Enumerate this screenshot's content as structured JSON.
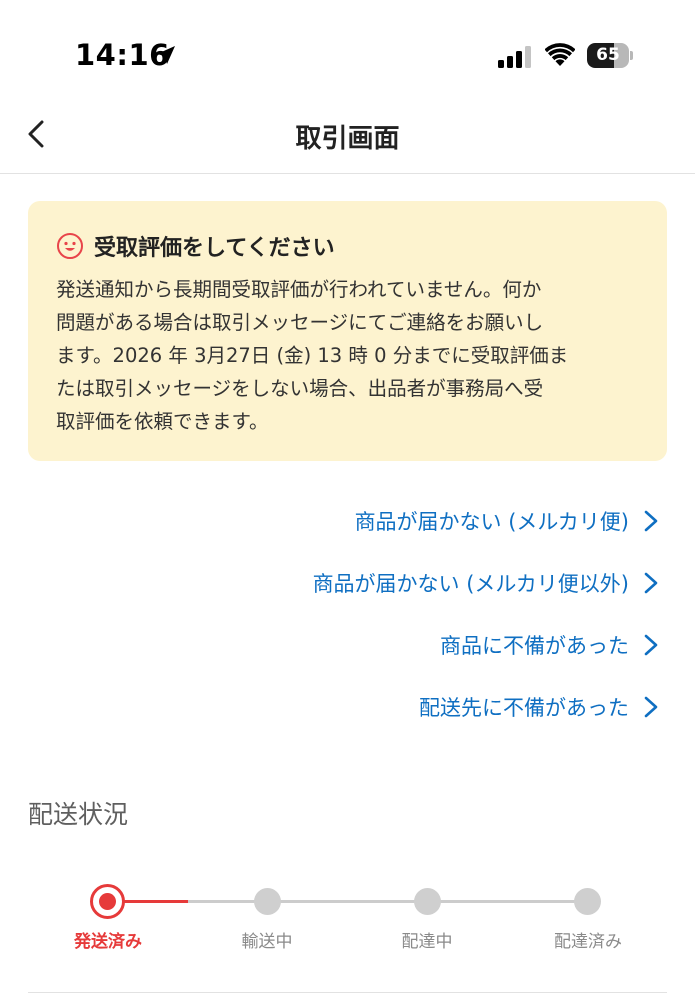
{
  "status_bar": {
    "time": "14:16",
    "battery_level": "65",
    "battery_fraction": 0.65,
    "location_icon": "location-arrow-icon",
    "signal_icon": "cellular-signal-icon",
    "wifi_icon": "wifi-icon"
  },
  "nav": {
    "title": "取引画面",
    "back_icon": "chevron-left-icon"
  },
  "notice": {
    "icon": "smiley-face-icon",
    "title": "受取評価をしてください",
    "body_lines": [
      "発送通知から長期間受取評価が行われていません。何か",
      "問題がある場合は取引メッセージにてご連絡をお願いし",
      "ます。2026 年 3月27日 (金) 13 時 0 分までに受取評価ま",
      "たは取引メッセージをしない場合、出品者が事務局へ受",
      "取評価を依頼できます。"
    ],
    "background_color": "#fdf3cf"
  },
  "links": [
    {
      "label": "商品が届かない (メルカリ便)"
    },
    {
      "label": "商品が届かない (メルカリ便以外)"
    },
    {
      "label": "商品に不備があった"
    },
    {
      "label": "配送先に不備があった"
    }
  ],
  "shipping_section": {
    "title": "配送状況",
    "steps": [
      {
        "label": "発送済み",
        "active": true
      },
      {
        "label": "輸送中",
        "active": false
      },
      {
        "label": "配達中",
        "active": false
      },
      {
        "label": "配達済み",
        "active": false
      }
    ]
  },
  "colors": {
    "link": "#0f6fc2",
    "accent_red": "#e63a3a",
    "inactive_gray": "#cfcfcf"
  }
}
